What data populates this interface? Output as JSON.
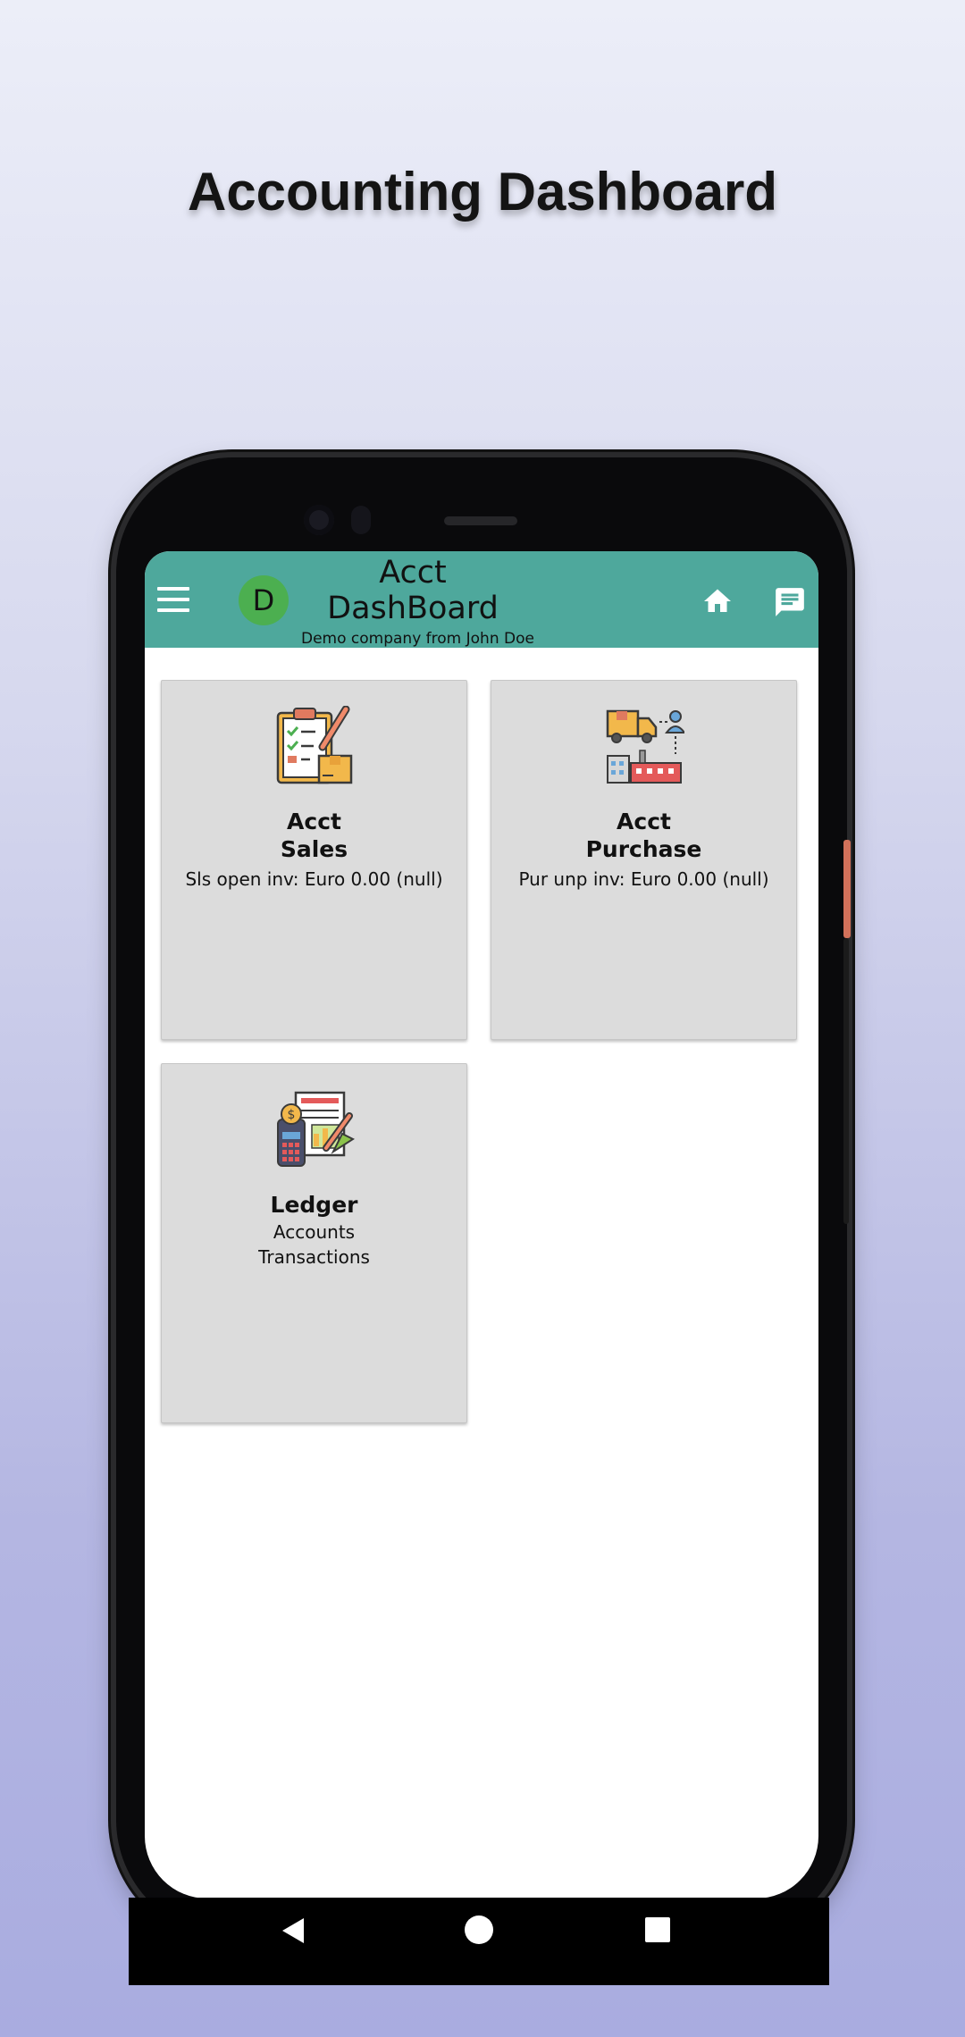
{
  "page": {
    "heading": "Accounting Dashboard"
  },
  "appbar": {
    "avatar_letter": "D",
    "title_line1": "Acct",
    "title_line2": "DashBoard",
    "subtitle": "Demo company from John Doe",
    "color": "#4ea89c"
  },
  "cards": [
    {
      "title": "Acct\nSales",
      "subtitle": "Sls open inv: Euro 0.00 (null)",
      "icon": "sales-clipboard-icon"
    },
    {
      "title": "Acct\nPurchase",
      "subtitle": "Pur unp inv: Euro 0.00 (null)",
      "icon": "purchase-truck-icon"
    },
    {
      "title": "Ledger",
      "subtitle_line1": "Accounts",
      "subtitle_line2": "Transactions",
      "icon": "ledger-calculator-icon"
    }
  ],
  "icons": [
    "menu-icon",
    "home-icon",
    "chat-icon"
  ]
}
